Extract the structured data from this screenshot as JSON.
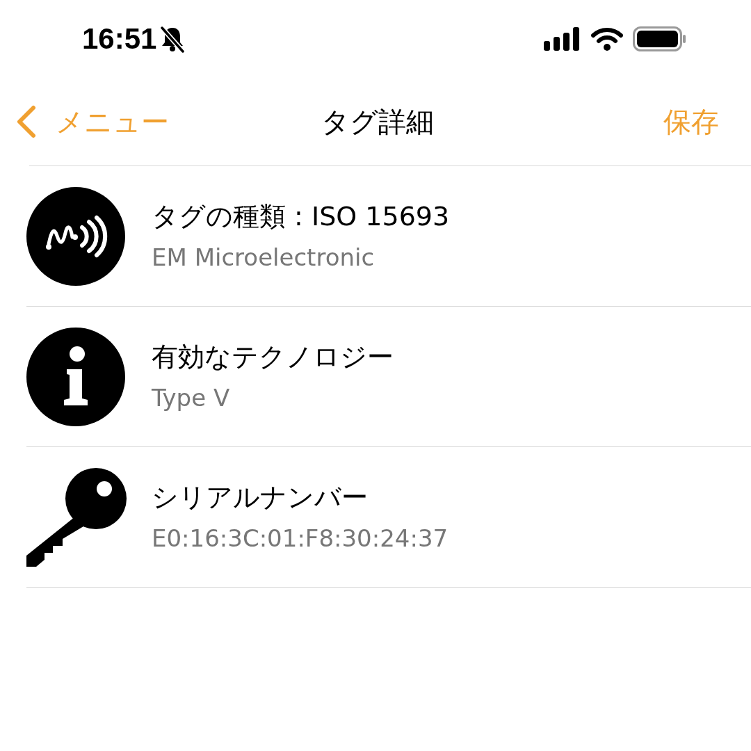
{
  "status_bar": {
    "time": "16:51"
  },
  "nav": {
    "back_label": "メニュー",
    "title": "タグ詳細",
    "action": "保存"
  },
  "rows": [
    {
      "kind": "tag",
      "title": "タグの種類 : ISO 15693",
      "subtitle": "EM Microelectronic"
    },
    {
      "kind": "info",
      "title": "有効なテクノロジー",
      "subtitle": "Type V"
    },
    {
      "kind": "key",
      "title": "シリアルナンバー",
      "subtitle": "E0:16:3C:01:F8:30:24:37"
    }
  ]
}
